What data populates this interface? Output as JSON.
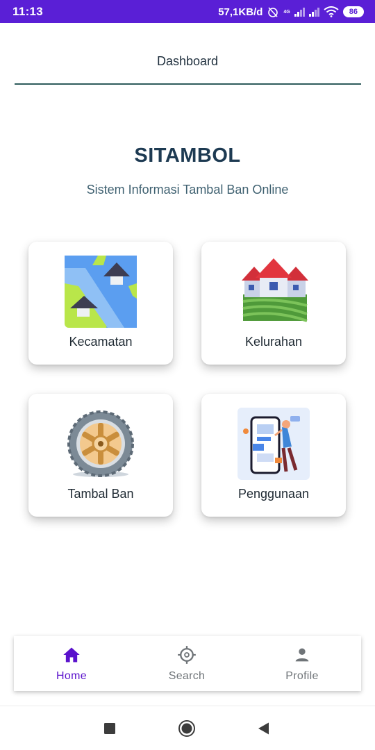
{
  "status_bar": {
    "time": "11:13",
    "speed": "57,1KB/d",
    "network": "4G",
    "battery": "86",
    "icons": [
      "alarm-off-icon",
      "signal-icon",
      "signal-icon",
      "wifi-icon",
      "battery-icon"
    ],
    "bg_color": "#5a1fd6"
  },
  "header": {
    "title": "Dashboard"
  },
  "app": {
    "title": "SITAMBOL",
    "subtitle": "Sistem Informasi Tambal Ban Online"
  },
  "menu": [
    {
      "label": "Kecamatan",
      "icon": "map-icon"
    },
    {
      "label": "Kelurahan",
      "icon": "village-icon"
    },
    {
      "label": "Tambal Ban",
      "icon": "tire-icon"
    },
    {
      "label": "Penggunaan",
      "icon": "usage-guide-icon"
    }
  ],
  "bottom_nav": {
    "items": [
      {
        "label": "Home",
        "icon": "home-icon",
        "active": true
      },
      {
        "label": "Search",
        "icon": "crosshair-icon",
        "active": false
      },
      {
        "label": "Profile",
        "icon": "person-icon",
        "active": false
      }
    ],
    "active_color": "#5a12cc",
    "inactive_color": "#6f7478"
  },
  "system_nav": [
    "recent-apps-icon",
    "home-circle-icon",
    "back-icon"
  ]
}
